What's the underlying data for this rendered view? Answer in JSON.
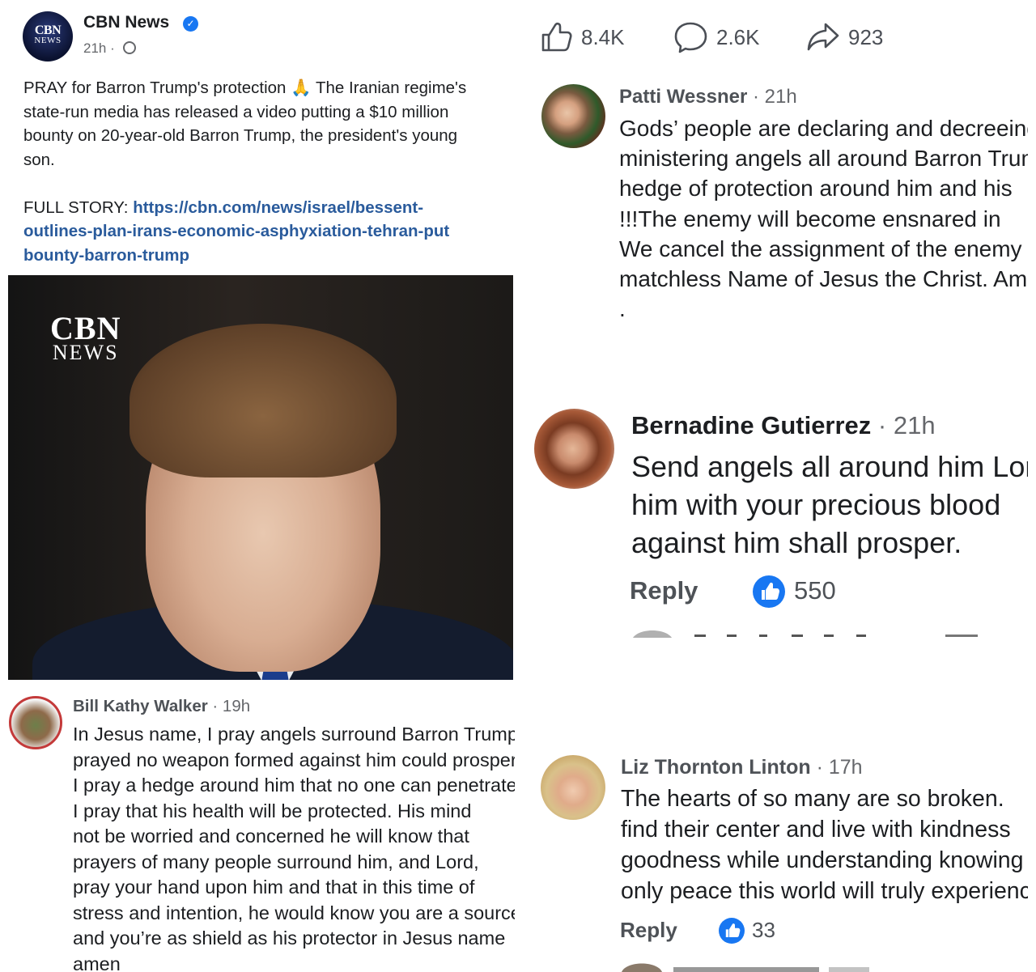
{
  "post": {
    "page_name": "CBN News",
    "time": "21h ·",
    "text_lines": [
      "PRAY for Barron Trump's protection 🙏 The Iranian regime's",
      "state-run media has released a video putting a $10 million",
      "bounty on 20-year-old Barron Trump, the president's young",
      "son."
    ],
    "full_story_label": "FULL STORY: ",
    "link_lines": [
      "https://cbn.com/news/israel/bessent-",
      "outlines-plan-irans-economic-asphyxiation-tehran-put",
      "bounty-barron-trump"
    ],
    "logo": {
      "line1": "CBN",
      "line2": "NEWS"
    },
    "image_watermark": {
      "line1": "CBN",
      "line2": "NEWS"
    }
  },
  "stats": {
    "likes": "8.4K",
    "comments": "2.6K",
    "shares": "923",
    "icons": [
      "thumbs-up-icon",
      "comment-bubble-icon",
      "share-arrow-icon"
    ]
  },
  "comments": {
    "patti": {
      "name": "Patti Wessner",
      "time": " · 21h",
      "lines": [
        "Gods’ people are declaring and decreeing",
        "ministering angels all around Barron Trump",
        "hedge of protection around him and his",
        "!!!The enemy will become ensnared in",
        "We cancel the assignment of the enemy",
        "matchless Name of Jesus the Christ. Amen",
        "."
      ]
    },
    "bernadine": {
      "name": "Bernadine Gutierrez",
      "time": " · 21h",
      "lines": [
        "Send angels all around him Lord",
        "him with your precious blood",
        "against him shall prosper."
      ],
      "reply_label": "Reply",
      "likes": "550"
    },
    "liz": {
      "name": "Liz Thornton Linton",
      "time": " · 17h",
      "lines": [
        "The hearts of so many are so broken.",
        "find their center and live with kindness",
        "goodness while understanding  knowing",
        "only peace this world will truly experience"
      ],
      "reply_label": "Reply",
      "likes": "33"
    },
    "bill": {
      "name": "Bill Kathy Walker",
      "time": " · 19h",
      "lines": [
        "In Jesus name, I pray angels surround Barron Trump",
        "prayed no weapon formed against him could prosper",
        "I pray a hedge around him that no one can penetrate",
        "I pray that his health will be protected. His mind",
        "not be worried and concerned he will know that",
        "prayers of many people surround him, and Lord,",
        "pray your hand upon him and that in this time of",
        "stress and intention, he would know you are a source",
        "and you’re as shield as his protector in Jesus name",
        "amen"
      ]
    }
  },
  "colors": {
    "link": "#2a5b9c",
    "like_blue": "#1877f2",
    "muted": "#65676b"
  }
}
